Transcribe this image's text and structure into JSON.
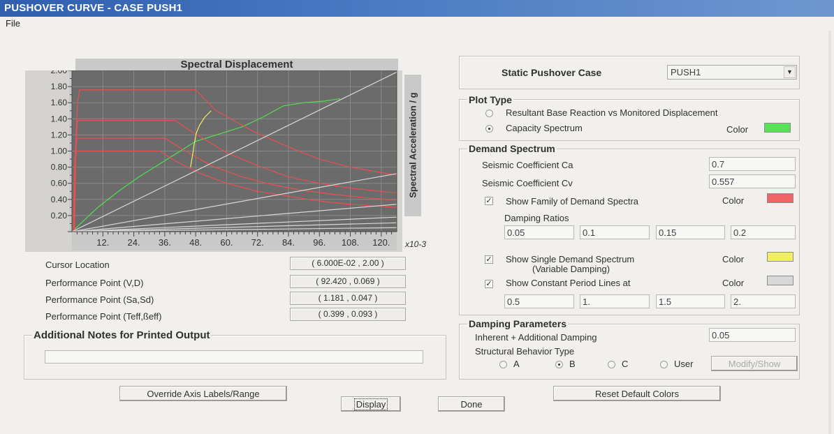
{
  "window": {
    "title": "PUSHOVER CURVE - CASE PUSH1"
  },
  "menu": {
    "file": "File"
  },
  "chart_data": {
    "type": "line",
    "title": "Spectral Displacement",
    "xlabel": "",
    "ylabel": "Spectral Acceleration / g",
    "x_multiplier_label": "x10-3",
    "xlim": [
      0,
      126
    ],
    "ylim": [
      0,
      2.0
    ],
    "x_ticks": [
      "12.",
      "24.",
      "36.",
      "48.",
      "60.",
      "72.",
      "84.",
      "96.",
      "108.",
      "120."
    ],
    "y_ticks": [
      "2.00",
      "1.80",
      "1.60",
      "1.40",
      "1.20",
      "1.00",
      "0.80",
      "0.60",
      "0.40",
      "0.20"
    ],
    "grid": true,
    "series": [
      {
        "color": "#50e050",
        "x": [
          0,
          4,
          10,
          18,
          26,
          34,
          42,
          48,
          58,
          66,
          74,
          82,
          90,
          98,
          104
        ],
        "y": [
          0,
          0.12,
          0.3,
          0.5,
          0.68,
          0.84,
          1.0,
          1.12,
          1.22,
          1.3,
          1.42,
          1.56,
          1.6,
          1.62,
          1.65
        ]
      },
      {
        "color": "#e85050",
        "x": [
          1,
          1.6,
          2.2,
          3,
          20,
          40,
          48,
          56,
          70,
          84,
          96,
          108,
          126
        ],
        "y": [
          0,
          1.2,
          1.6,
          1.76,
          1.76,
          1.76,
          1.76,
          1.5,
          1.25,
          1.05,
          0.9,
          0.8,
          0.7
        ]
      },
      {
        "color": "#e85050",
        "x": [
          0.8,
          1.3,
          2.2,
          20,
          40,
          46,
          60,
          72,
          84,
          96,
          108,
          126
        ],
        "y": [
          0,
          1.0,
          1.38,
          1.38,
          1.38,
          1.25,
          0.98,
          0.82,
          0.68,
          0.6,
          0.54,
          0.48
        ]
      },
      {
        "color": "#e85050",
        "x": [
          0.6,
          1.1,
          2.0,
          20,
          36,
          42,
          54,
          66,
          78,
          90,
          102,
          114,
          126
        ],
        "y": [
          0,
          0.9,
          1.16,
          1.16,
          1.16,
          1.04,
          0.82,
          0.68,
          0.58,
          0.51,
          0.46,
          0.42,
          0.39
        ]
      },
      {
        "color": "#e85050",
        "x": [
          0.5,
          1.0,
          1.8,
          20,
          34,
          40,
          50,
          60,
          72,
          84,
          96,
          108,
          126
        ],
        "y": [
          0,
          0.8,
          1.0,
          1.0,
          1.0,
          0.88,
          0.72,
          0.6,
          0.5,
          0.44,
          0.38,
          0.34,
          0.3
        ]
      },
      {
        "color": "#f0f060",
        "x": [
          46,
          46.8,
          47.4,
          48.2,
          49.5,
          51.5,
          54
        ],
        "y": [
          0.8,
          0.95,
          1.08,
          1.22,
          1.32,
          1.42,
          1.5
        ]
      },
      {
        "color": "#d8d8d8",
        "x": [
          0,
          126
        ],
        "y": [
          0,
          1.98
        ]
      },
      {
        "color": "#d8d8d8",
        "x": [
          0,
          126
        ],
        "y": [
          0,
          0.72
        ]
      },
      {
        "color": "#d8d8d8",
        "x": [
          0,
          126
        ],
        "y": [
          0,
          0.34
        ]
      },
      {
        "color": "#d8d8d8",
        "x": [
          0,
          126
        ],
        "y": [
          0,
          0.18
        ]
      },
      {
        "color": "#d8d8d8",
        "x": [
          0,
          126
        ],
        "y": [
          0,
          0.11
        ]
      },
      {
        "color": "#d8d8d8",
        "x": [
          0,
          126
        ],
        "y": [
          0,
          0.05
        ]
      }
    ]
  },
  "info": {
    "cursor_label": "Cursor Location",
    "cursor_value": "( 6.000E-02 , 2.00 )",
    "pp_vd_label": "Performance Point (V,D)",
    "pp_vd_value": "( 92.420 , 0.069 )",
    "pp_sasd_label": "Performance Point (Sa,Sd)",
    "pp_sasd_value": "( 1.181 , 0.047 )",
    "pp_teff_label": "Performance Point (Teff,ßeff)",
    "pp_teff_value": "( 0.399 , 0.093 )"
  },
  "notes": {
    "title": "Additional Notes for Printed Output",
    "value": ""
  },
  "buttons": {
    "override": "Override Axis Labels/Range",
    "display": "Display",
    "done": "Done",
    "reset": "Reset Default Colors",
    "modify": "Modify/Show"
  },
  "static_case": {
    "label": "Static Pushover Case",
    "selected": "PUSH1"
  },
  "plot_type": {
    "title": "Plot Type",
    "option1": "Resultant Base Reaction vs Monitored Displacement",
    "option2": "Capacity Spectrum",
    "selected": "Capacity Spectrum",
    "color_label": "Color",
    "color": "#58e058"
  },
  "demand": {
    "title": "Demand Spectrum",
    "ca_label": "Seismic Coefficient  Ca",
    "ca_value": "0.7",
    "cv_label": "Seismic Coefficient  Cv",
    "cv_value": "0.557",
    "family_label": "Show Family of Demand Spectra",
    "family_checked": true,
    "family_color_label": "Color",
    "family_color": "#ef6464",
    "damping_label": "Damping Ratios",
    "damping_ratios": [
      "0.05",
      "0.1",
      "0.15",
      "0.2"
    ],
    "single_label_1": "Show Single  Demand Spectrum",
    "single_label_2": "(Variable Damping)",
    "single_checked": true,
    "single_color_label": "Color",
    "single_color": "#f0f060",
    "period_label": "Show Constant Period Lines at",
    "period_checked": true,
    "period_color_label": "Color",
    "period_color": "#d8d8d8",
    "periods": [
      "0.5",
      "1.",
      "1.5",
      "2."
    ]
  },
  "damping": {
    "title": "Damping Parameters",
    "inherent_label": "Inherent + Additional Damping",
    "inherent_value": "0.05",
    "behavior_label": "Structural Behavior Type",
    "options": [
      "A",
      "B",
      "C",
      "User"
    ],
    "selected": "B"
  }
}
